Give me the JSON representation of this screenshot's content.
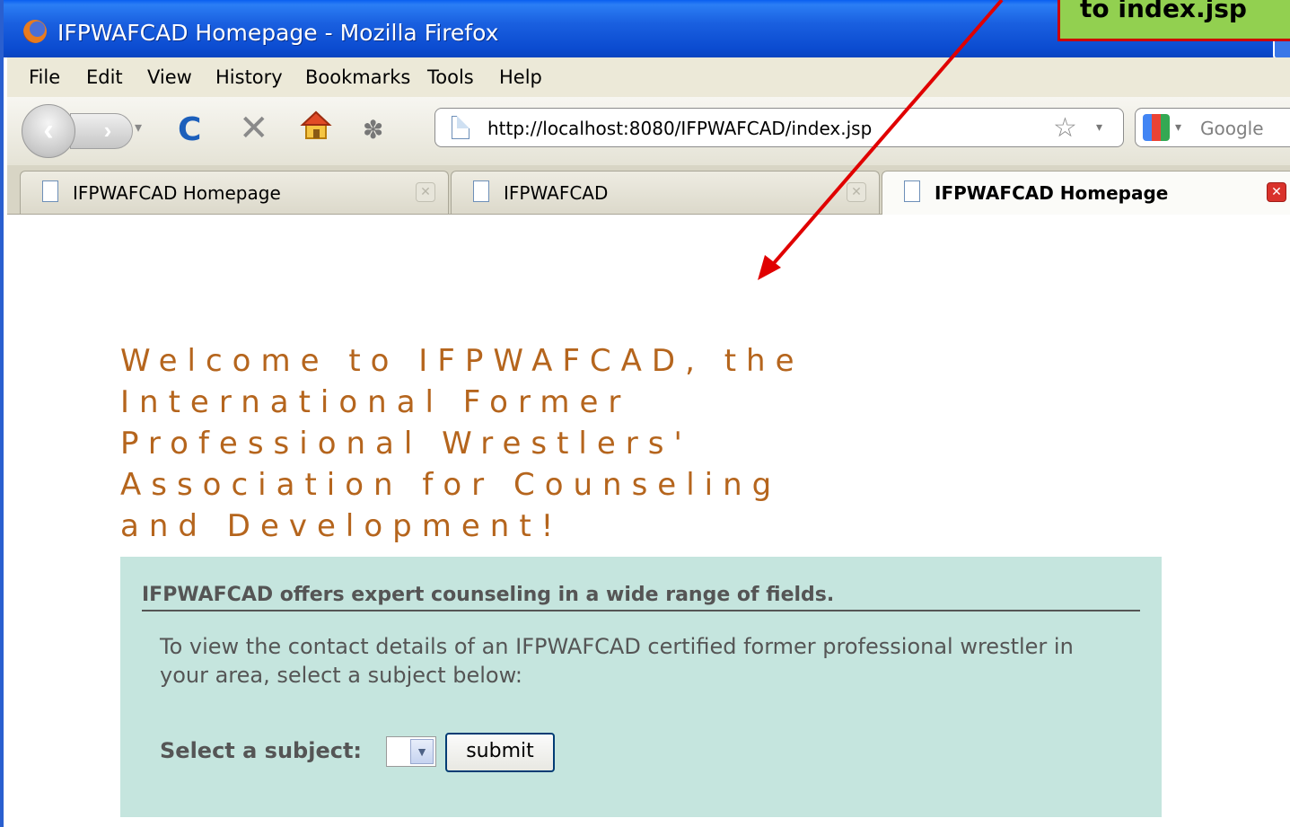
{
  "window": {
    "title": "IFPWAFCAD Homepage - Mozilla Firefox"
  },
  "annotation": {
    "text": "to index.jsp"
  },
  "menu": [
    "File",
    "Edit",
    "View",
    "History",
    "Bookmarks",
    "Tools",
    "Help"
  ],
  "toolbar": {
    "url": "http://localhost:8080/IFPWAFCAD/index.jsp",
    "search_placeholder": "Google"
  },
  "tabs": [
    {
      "label": "IFPWAFCAD Homepage",
      "active": false
    },
    {
      "label": "IFPWAFCAD",
      "active": false
    },
    {
      "label": "IFPWAFCAD Homepage",
      "active": true
    }
  ],
  "page": {
    "welcome_lines": [
      "Welcome to IFPWAFCAD, the",
      "International Former",
      "Professional Wrestlers'",
      "Association for Counseling",
      "and Development!"
    ],
    "subheading": "IFPWAFCAD offers expert counseling in a wide range of fields.",
    "description": "To view the contact details of an IFPWAFCAD certified former professional wrestler in your area, select a subject below:",
    "select_label": "Select a subject:",
    "select_value": "",
    "submit_label": "submit"
  },
  "colors": {
    "welcome_text": "#b5651d",
    "panel_bg": "#c5e5de",
    "annotation_bg": "#92d050",
    "annotation_border": "#cc0000",
    "arrow": "#e00000"
  }
}
